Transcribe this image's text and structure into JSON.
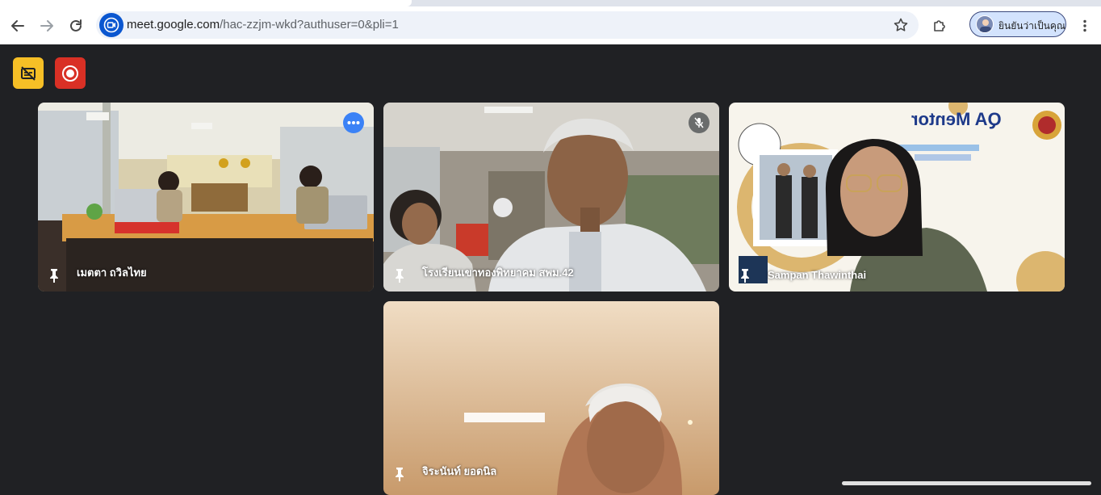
{
  "browser": {
    "url_host": "meet.google.com",
    "url_path": "/hac-zzjm-wkd?authuser=0&pli=1",
    "profile_label": "ยินยันว่าเป็นคุณ",
    "icons": {
      "back": "arrow-left-icon",
      "forward": "arrow-right-icon",
      "reload": "reload-icon",
      "site": "meet-video-icon",
      "bookmark": "star-icon",
      "extensions": "puzzle-icon",
      "menu": "kebab-menu-icon"
    }
  },
  "meet": {
    "top_buttons": [
      {
        "icon": "captions-off-icon",
        "color": "#f6bf26"
      },
      {
        "icon": "record-icon",
        "color": "#d93025"
      }
    ],
    "tiles": [
      {
        "name": "เมตตา ถวิลไทย",
        "state": "more-options"
      },
      {
        "name": "โรงเรียนเขาทองพิทยาคม สพม.42",
        "state": "muted"
      },
      {
        "name": "Sampan Thawinthai",
        "banner_title": "QA Mentor",
        "state": "presenting"
      },
      {
        "name": "จิระนันท์ ยอดนิล",
        "state": "normal"
      }
    ]
  },
  "colors": {
    "background": "#202124",
    "accent": "#0b57d0"
  }
}
